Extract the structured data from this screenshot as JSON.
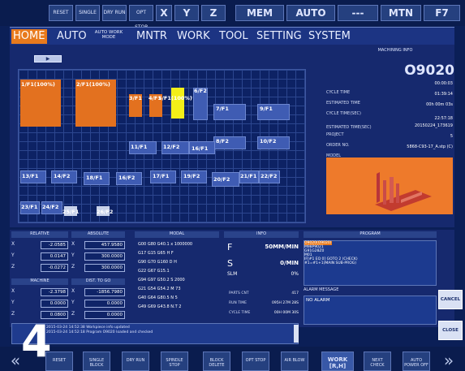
{
  "topbar": {
    "buttons": [
      "RESET",
      "SINGLE",
      "DRY RUN",
      "OPT STOP",
      "X",
      "Y",
      "Z",
      "MEM",
      "AUTO",
      "---",
      "MTN",
      "F7"
    ]
  },
  "menu": {
    "items": [
      "HOME",
      "AUTO",
      "AUTO WORK MODE",
      "MNTR",
      "WORK",
      "TOOL",
      "SETTING",
      "SYSTEM"
    ],
    "active": "HOME"
  },
  "main": {
    "play_label": "▶",
    "cells": [
      {
        "label": "1/F1(100%)"
      },
      {
        "label": "2/F1(100%)"
      },
      {
        "label": "3/F1"
      },
      {
        "label": "4/F1"
      },
      {
        "label": "5/F1(100%)"
      },
      {
        "label": "6/F2"
      },
      {
        "label": "7/F1"
      },
      {
        "label": "9/F1"
      },
      {
        "label": "8/F2"
      },
      {
        "label": "10/F2"
      },
      {
        "label": "11/F1"
      },
      {
        "label": "12/F2"
      },
      {
        "label": "16/F1"
      },
      {
        "label": "13/F1"
      },
      {
        "label": "14/F2"
      },
      {
        "label": "18/F1"
      },
      {
        "label": "16/F2"
      },
      {
        "label": "17/F1"
      },
      {
        "label": "19/F2"
      },
      {
        "label": "20/F2"
      },
      {
        "label": "21/F1"
      },
      {
        "label": "22/F2"
      },
      {
        "label": "23/F1"
      },
      {
        "label": "24/F2"
      },
      {
        "label": "25/F1"
      },
      {
        "label": "26/F2"
      }
    ]
  },
  "info": {
    "header": "MACHINING INFO",
    "program": "O9020",
    "rows": [
      {
        "label": "CYCLE TIME",
        "value": "00:00:03"
      },
      {
        "label": "ESTIMATED TIME",
        "value": "01:39:14"
      },
      {
        "label": "CYCLE TIME(SEC)",
        "value": "00h 00m 03s"
      },
      {
        "label": "ESTIMATED TIME(SEC)",
        "value": "22:57:18"
      },
      {
        "label": "PROJECT",
        "value": "20150224_173619"
      },
      {
        "label": "ORDER NO.",
        "value": "5"
      },
      {
        "label": "MODEL",
        "value": "5868-C93-17_A.stp (C)"
      }
    ]
  },
  "position": {
    "relative_title": "RELATIVE",
    "absolute_title": "ABSOLUTE",
    "machine_title": "MACHINE",
    "dist_title": "DIST. TO GO",
    "axes": [
      "X",
      "Y",
      "Z"
    ],
    "relative": [
      "-2.0585",
      "0.0147",
      "-0.0272"
    ],
    "absolute": [
      "457.9580",
      "300.0000",
      "300.0000"
    ],
    "machine": [
      "-2.3798",
      "0.0000",
      "0.0800"
    ],
    "dist": [
      "-1856.7980",
      "0.0000",
      "0.0000"
    ]
  },
  "modal": {
    "title": "MODAL",
    "rows": [
      "G00  G80  G40.1  x  1000000",
      "G17  G15  G65    H  F",
      "G90  G70  G160   D  H",
      "G22  G67  G15.1",
      "G94  G97  G50.2  S  2000",
      "G21  G54  G54.2  M  73",
      "G40  G64  G80.5  N  5",
      "G49  G69  G43.8  N.T  2"
    ]
  },
  "info2": {
    "title": "INFO",
    "feed_label": "F",
    "feed_value": "50MM/MIN",
    "spindle_label": "S",
    "spindle_value": "0/MIN",
    "load_label": "SLM",
    "load_value": "0%",
    "parts_label": "PARTS CNT",
    "parts_value": "417",
    "run_label": "RUN TIME",
    "run_value": "095H 27M 28S",
    "cycle_label": "CYCLE TIME",
    "cycle_value": "00H 00M 30S"
  },
  "program": {
    "title": "PROGRAM",
    "lines": [
      "O9020(O9020)",
      "M98P9021",
      "G91G28Z0",
      "M01",
      "IF[#1 EQ 0] GOTO 2 (CHECK)",
      "#1=#1+1(MAIN SUB-PROG)"
    ],
    "alarm_title": "ALARM MESSAGE",
    "alarm_text": "NO ALARM"
  },
  "messages": [
    "2015-03-24 14:52:38 Workpiece info updated",
    "2015-03-24 14:52:18 Program O9020 loaded and checked"
  ],
  "side": {
    "cancel": "CANCEL",
    "close": "CLOSE"
  },
  "footer": {
    "buttons": [
      "RESET",
      "SINGLE BLOCK",
      "DRY RUN",
      "SPINDLE STOP",
      "BLOCK DELETE",
      "OPT STOP",
      "AIR BLOW",
      "WORK [R,H]",
      "NEXT CHECK",
      "AUTO POWER OFF"
    ],
    "active_index": 7,
    "step": "4"
  }
}
